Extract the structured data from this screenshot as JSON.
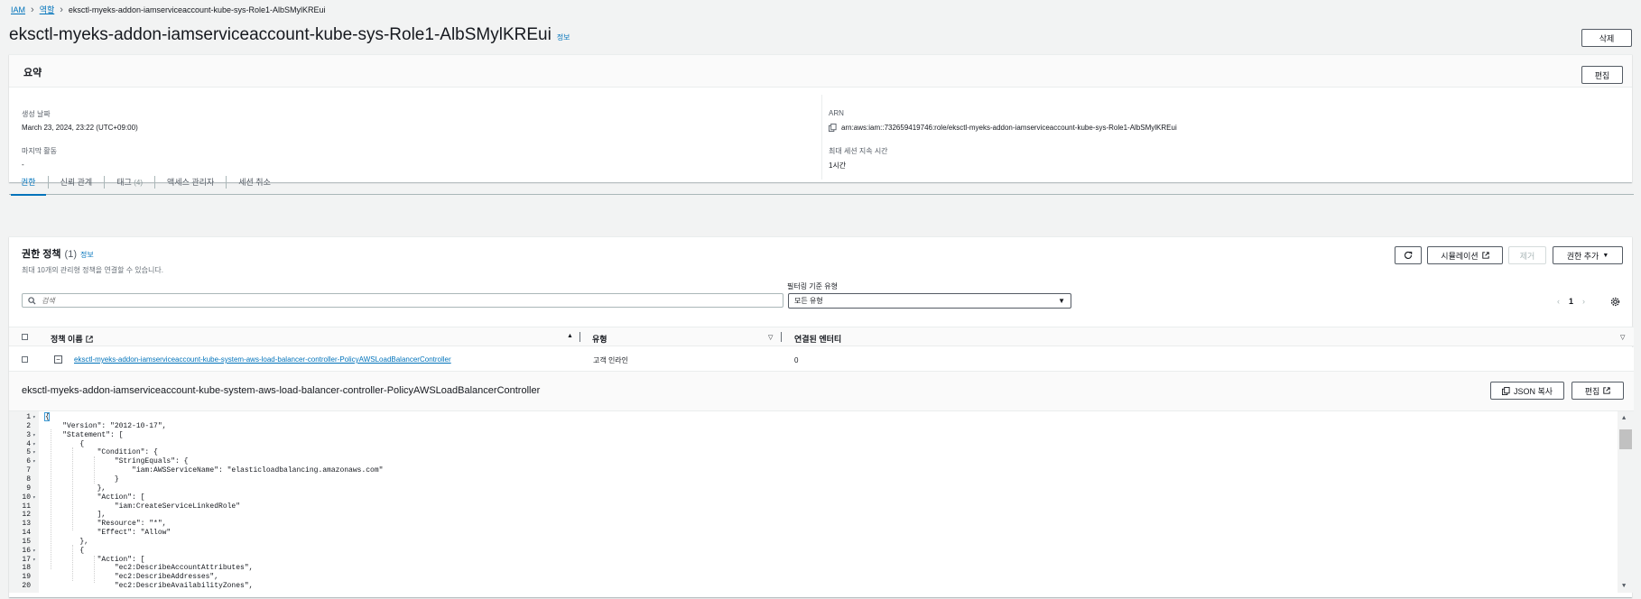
{
  "breadcrumb": {
    "items": [
      "IAM",
      "역할",
      "eksctl-myeks-addon-iamserviceaccount-kube-sys-Role1-AlbSMylKREui"
    ]
  },
  "header": {
    "title": "eksctl-myeks-addon-iamserviceaccount-kube-sys-Role1-AlbSMylKREui",
    "info_label": "정보",
    "delete_label": "삭제"
  },
  "summary": {
    "title": "요약",
    "edit_label": "편집",
    "created_label": "생성 날짜",
    "created_value": "March 23, 2024, 23:22 (UTC+09:00)",
    "last_activity_label": "마지막 활동",
    "last_activity_value": "-",
    "arn_label": "ARN",
    "arn_value": "arn:aws:iam::732659419746:role/eksctl-myeks-addon-iamserviceaccount-kube-sys-Role1-AlbSMylKREui",
    "max_session_label": "최대 세션 지속 시간",
    "max_session_value": "1시간"
  },
  "tabs": [
    {
      "label": "권한",
      "active": true
    },
    {
      "label": "신뢰 관계"
    },
    {
      "label": "태그",
      "count": "(4)"
    },
    {
      "label": "액세스 관리자"
    },
    {
      "label": "세션 취소"
    }
  ],
  "permissions": {
    "title": "권한 정책",
    "count": "(1)",
    "info_label": "정보",
    "subtitle": "최대 10개의 관리형 정책을 연결할 수 있습니다.",
    "simulate_label": "시뮬레이션",
    "remove_label": "제거",
    "add_label": "권한 추가",
    "filter_label": "필터링 기준 유형",
    "search_placeholder": "검색",
    "filter_value": "모든 유형",
    "page_number": "1",
    "columns": [
      "정책 이름",
      "유형",
      "연결된 엔터티"
    ],
    "rows": [
      {
        "name": "eksctl-myeks-addon-iamserviceaccount-kube-system-aws-load-balancer-controller-PolicyAWSLoadBalancerController",
        "type": "고객 인라인",
        "attached": "0"
      }
    ]
  },
  "policy_detail": {
    "name": "eksctl-myeks-addon-iamserviceaccount-kube-system-aws-load-balancer-controller-PolicyAWSLoadBalancerController",
    "copy_json_label": "JSON 복사",
    "edit_label": "편집",
    "line_numbers": [
      "1",
      "2",
      "3",
      "4",
      "5",
      "6",
      "7",
      "8",
      "9",
      "10",
      "11",
      "12",
      "13",
      "14",
      "15",
      "16",
      "17",
      "18",
      "19",
      "20"
    ],
    "folds": [
      true,
      false,
      true,
      true,
      true,
      true,
      false,
      false,
      false,
      true,
      false,
      false,
      false,
      false,
      false,
      true,
      true,
      false,
      false,
      false
    ],
    "code_lines": [
      "{",
      "    \"Version\": \"2012-10-17\",",
      "    \"Statement\": [",
      "        {",
      "            \"Condition\": {",
      "                \"StringEquals\": {",
      "                    \"iam:AWSServiceName\": \"elasticloadbalancing.amazonaws.com\"",
      "                }",
      "            },",
      "            \"Action\": [",
      "                \"iam:CreateServiceLinkedRole\"",
      "            ],",
      "            \"Resource\": \"*\",",
      "            \"Effect\": \"Allow\"",
      "        },",
      "        {",
      "            \"Action\": [",
      "                \"ec2:DescribeAccountAttributes\",",
      "                \"ec2:DescribeAddresses\",",
      "                \"ec2:DescribeAvailabilityZones\","
    ]
  },
  "colors": {
    "link": "#0073bb",
    "background": "#f2f3f3",
    "border": "#aab7b8"
  }
}
